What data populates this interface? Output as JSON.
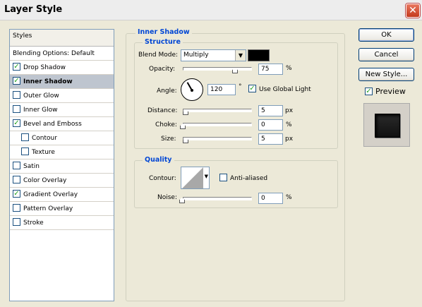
{
  "window": {
    "title": "Layer Style"
  },
  "styles_list": {
    "header": "Styles",
    "blending_label": "Blending Options: Default",
    "items": [
      {
        "label": "Drop Shadow",
        "checked": true
      },
      {
        "label": "Inner Shadow",
        "checked": true,
        "selected": true
      },
      {
        "label": "Outer Glow",
        "checked": false
      },
      {
        "label": "Inner Glow",
        "checked": false
      },
      {
        "label": "Bevel and Emboss",
        "checked": true
      },
      {
        "label": "Contour",
        "checked": false,
        "sub": true
      },
      {
        "label": "Texture",
        "checked": false,
        "sub": true
      },
      {
        "label": "Satin",
        "checked": false
      },
      {
        "label": "Color Overlay",
        "checked": false
      },
      {
        "label": "Gradient Overlay",
        "checked": true
      },
      {
        "label": "Pattern Overlay",
        "checked": false
      },
      {
        "label": "Stroke",
        "checked": false
      }
    ]
  },
  "panel": {
    "title": "Inner Shadow",
    "structure": {
      "title": "Structure",
      "blend_mode_label": "Blend Mode:",
      "blend_mode_value": "Multiply",
      "color": "#000000",
      "opacity_label": "Opacity:",
      "opacity_value": "75",
      "opacity_unit": "%",
      "opacity_fraction": 0.75,
      "angle_label": "Angle:",
      "angle_value": "120",
      "angle_unit": "°",
      "use_global_light_label": "Use Global Light",
      "use_global_light": true,
      "distance_label": "Distance:",
      "distance_value": "5",
      "distance_unit": "px",
      "choke_label": "Choke:",
      "choke_value": "0",
      "choke_unit": "%",
      "size_label": "Size:",
      "size_value": "5",
      "size_unit": "px"
    },
    "quality": {
      "title": "Quality",
      "contour_label": "Contour:",
      "anti_aliased_label": "Anti-aliased",
      "anti_aliased": false,
      "noise_label": "Noise:",
      "noise_value": "0",
      "noise_unit": "%"
    }
  },
  "buttons": {
    "ok": "OK",
    "cancel": "Cancel",
    "new_style": "New Style..."
  },
  "preview": {
    "label": "Preview",
    "checked": true
  }
}
